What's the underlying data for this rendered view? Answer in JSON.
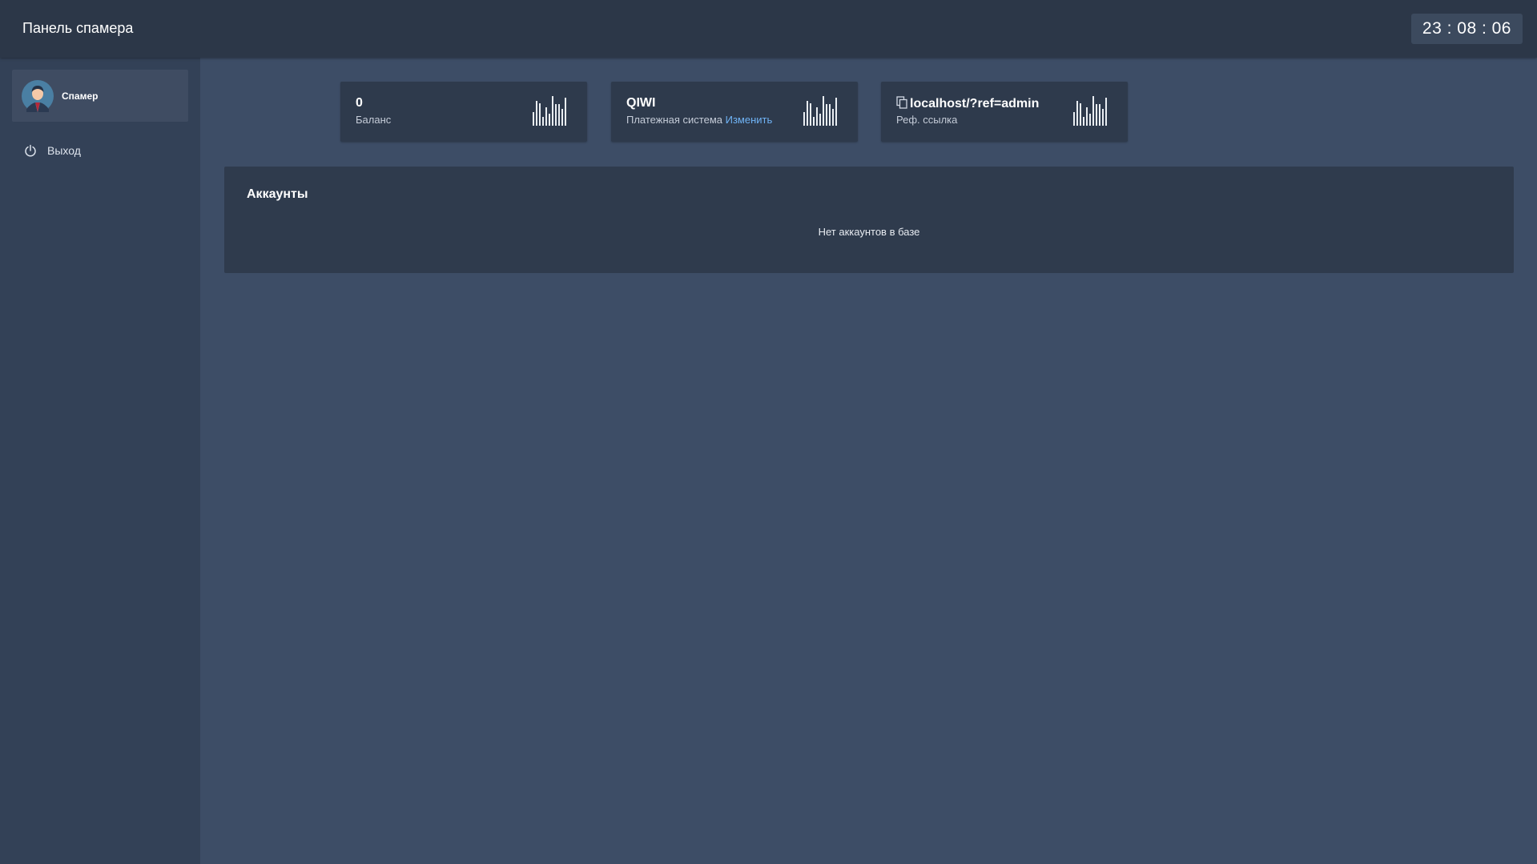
{
  "header": {
    "title": "Панель спамера",
    "clock": "23 : 08 : 06"
  },
  "sidebar": {
    "user": {
      "name": "Спамер",
      "avatar_icon": "user-avatar-icon"
    },
    "logout": {
      "label": "Выход",
      "icon": "power-icon"
    }
  },
  "stats": [
    {
      "value": "0",
      "label": "Баланс",
      "icon": "bar-chart-icon"
    },
    {
      "value": "QIWI",
      "label": "Платежная система",
      "link": "Изменить",
      "icon": "bar-chart-icon"
    },
    {
      "value": "localhost/?ref=admin",
      "label": "Реф. ссылка",
      "copy_icon": "copy-icon",
      "icon": "bar-chart-icon"
    }
  ],
  "accounts": {
    "title": "Аккаунты",
    "empty_message": "Нет аккаунтов в базе"
  },
  "colors": {
    "background": "#3d4d66",
    "topbar": "#2c3748",
    "sidebar": "#334157",
    "card": "#2e3a4c",
    "link": "#6fb3f5"
  }
}
